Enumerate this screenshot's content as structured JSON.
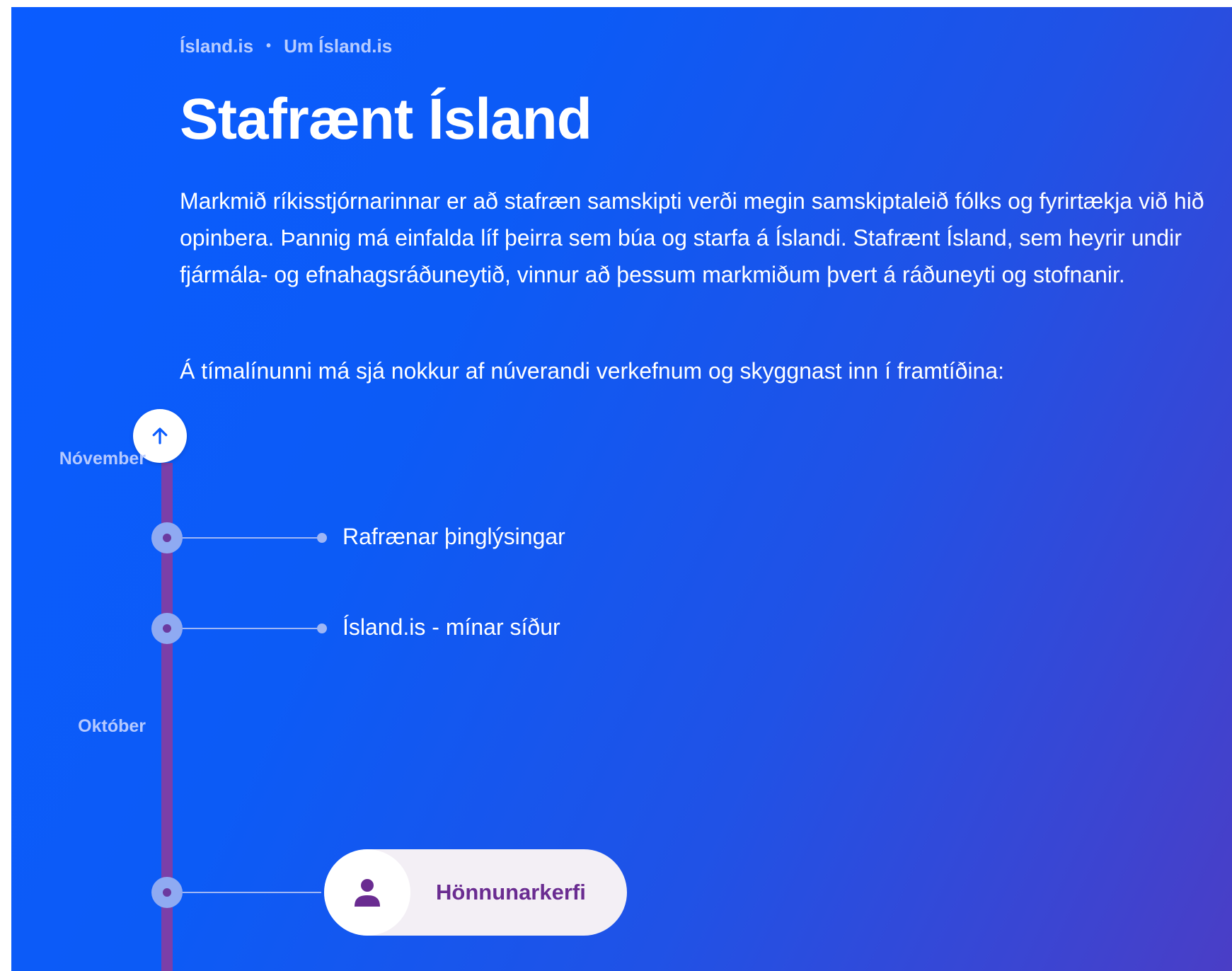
{
  "breadcrumb": {
    "items": [
      "Ísland.is",
      "Um Ísland.is"
    ],
    "separator": "•"
  },
  "page": {
    "title": "Stafrænt Ísland",
    "intro": "Markmið ríkisstjórnarinnar er að stafræn samskipti verði megin samskiptaleið fólks og fyrirtækja við hið opinbera. Þannig má einfalda líf þeirra sem búa og starfa á Íslandi. Stafrænt Ísland, sem heyrir undir fjármála- og efnahagsráðuneytið, vinnur að þessum markmiðum þvert á ráðuneyti og stofnanir.",
    "subintro": "Á tímalínunni má sjá nokkur af núverandi verkefnum og skyggnast inn í framtíðina:"
  },
  "timeline": {
    "up_icon": "arrow-up-icon",
    "months": [
      "Nóvember",
      "Október"
    ],
    "events": [
      {
        "label": "Rafrænar þinglýsingar"
      },
      {
        "label": "Ísland.is - mínar síður"
      }
    ],
    "card": {
      "label": "Hönnunarkerfi",
      "icon": "person-icon"
    }
  },
  "colors": {
    "background_start": "#0a5cff",
    "background_end": "#4a3ec6",
    "timeline_line": "#7b3fa8",
    "accent_purple": "#6a2c91",
    "node": "#8faaf2"
  }
}
